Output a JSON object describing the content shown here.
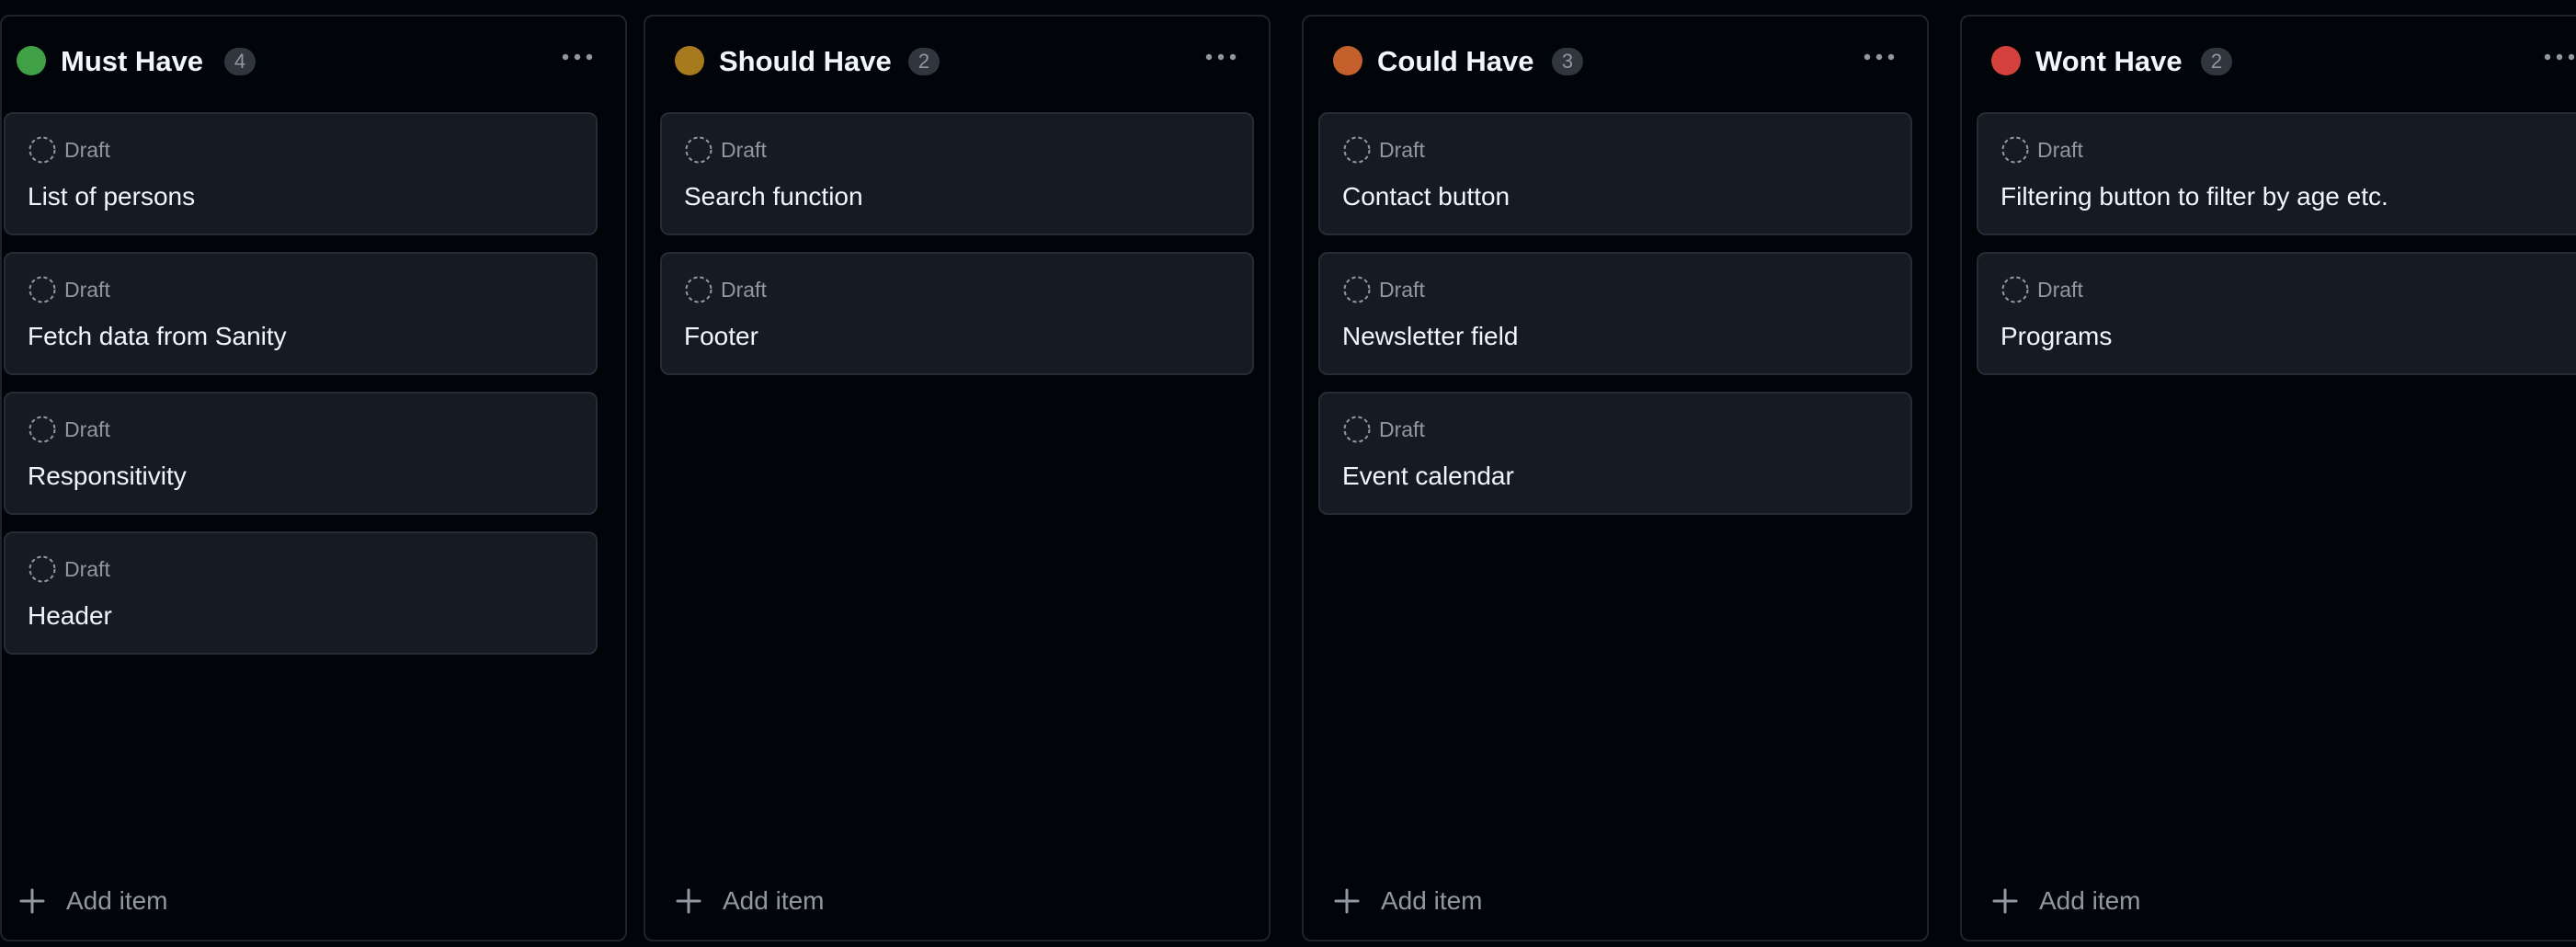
{
  "board": {
    "columns": [
      {
        "title": "Must Have",
        "count": "4",
        "dot_color": "#3fa045",
        "cards": [
          {
            "status": "Draft",
            "title": "List of persons"
          },
          {
            "status": "Draft",
            "title": "Fetch data from Sanity"
          },
          {
            "status": "Draft",
            "title": "Responsitivity"
          },
          {
            "status": "Draft",
            "title": "Header"
          }
        ],
        "add_label": "Add item"
      },
      {
        "title": "Should Have",
        "count": "2",
        "dot_color": "#a87a1e",
        "cards": [
          {
            "status": "Draft",
            "title": "Search function"
          },
          {
            "status": "Draft",
            "title": "Footer"
          }
        ],
        "add_label": "Add item"
      },
      {
        "title": "Could Have",
        "count": "3",
        "dot_color": "#c3602c",
        "cards": [
          {
            "status": "Draft",
            "title": "Contact button"
          },
          {
            "status": "Draft",
            "title": "Newsletter field"
          },
          {
            "status": "Draft",
            "title": "Event calendar"
          }
        ],
        "add_label": "Add item"
      },
      {
        "title": "Wont Have",
        "count": "2",
        "dot_color": "#d4403b",
        "cards": [
          {
            "status": "Draft",
            "title": "Filtering button to filter by age etc."
          },
          {
            "status": "Draft",
            "title": "Programs"
          }
        ],
        "add_label": "Add item"
      }
    ]
  },
  "icons": {
    "draft": "draft-circle-icon",
    "more": "kebab-menu-icon",
    "add": "plus-icon"
  }
}
